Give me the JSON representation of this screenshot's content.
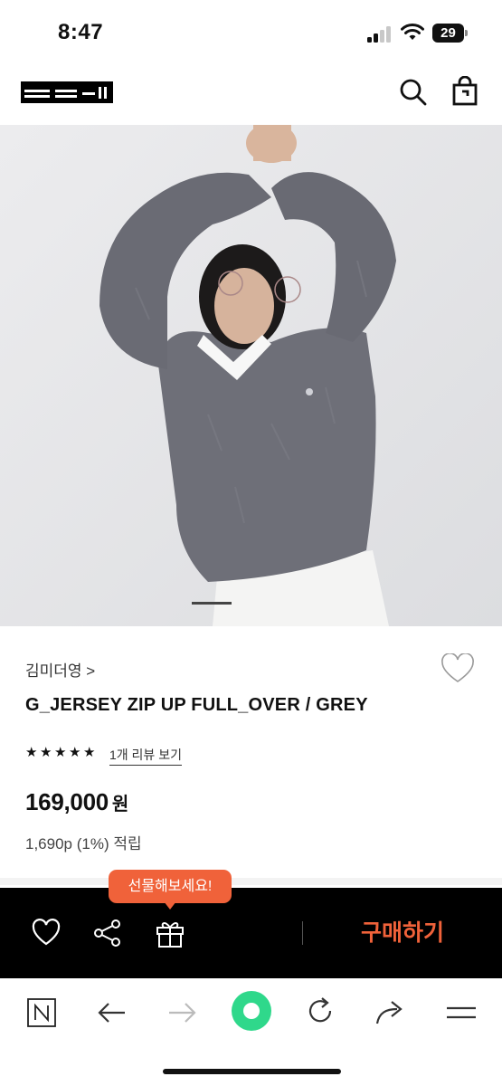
{
  "status_bar": {
    "time": "8:47",
    "battery": "29"
  },
  "header": {
    "logo_icon": "brand-logo",
    "search_icon": "search-icon",
    "cart_icon": "shopping-bag-icon"
  },
  "product": {
    "brand": "김미더영 >",
    "name": "G_JERSEY ZIP UP FULL_OVER / GREY",
    "rating_stars": 5,
    "review_link": "1개 리뷰 보기",
    "price": "169,000",
    "price_unit": "원",
    "points": "1,690p (1%) 적립"
  },
  "gallery": {
    "current_slide": 1
  },
  "gift_tooltip": "선물해보세요!",
  "action_bar": {
    "wish_icon": "heart-icon",
    "share_icon": "share-icon",
    "gift_icon": "gift-icon",
    "buy_label": "구매하기"
  },
  "browser_toolbar": {
    "items": [
      "naver-home-icon",
      "back-arrow-icon",
      "forward-arrow-icon",
      "green-dot-icon",
      "reload-icon",
      "share-arrow-icon",
      "menu-icon"
    ]
  },
  "colors": {
    "accent": "#f0623a",
    "bar_bg": "#000000",
    "green_button": "#2fd88b"
  }
}
